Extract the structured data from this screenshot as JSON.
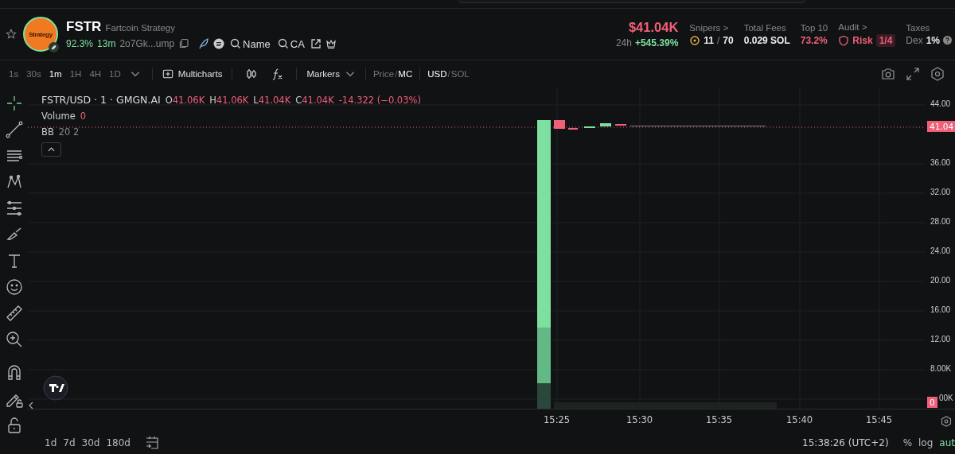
{
  "token": {
    "symbol": "FSTR",
    "name": "Fartcoin Strategy",
    "logo_text": "Strategy",
    "holders_pct": "92.3%",
    "age": "13m",
    "address": "2o7Gk...ump",
    "search_links": [
      "Name",
      "CA"
    ]
  },
  "stats": {
    "price": "$41.04K",
    "period": "24h",
    "change": "+545.39%",
    "snipers": {
      "label": "Snipers >",
      "count": "11",
      "separator": "/",
      "total": "70"
    },
    "fees": {
      "label": "Total Fees",
      "value": "0.029 SOL"
    },
    "top10": {
      "label": "Top 10",
      "value": "73.2%"
    },
    "audit": {
      "label": "Audit >",
      "risk": "Risk",
      "score": "1/4"
    },
    "taxes": {
      "label": "Taxes",
      "dex": "Dex",
      "value": "1%"
    }
  },
  "intervals": [
    {
      "label": "1s",
      "selected": false
    },
    {
      "label": "30s",
      "selected": false
    },
    {
      "label": "1m",
      "selected": true
    },
    {
      "label": "1H",
      "selected": false
    },
    {
      "label": "4H",
      "selected": false
    },
    {
      "label": "1D",
      "selected": false
    }
  ],
  "toolbar": {
    "multicharts": "Multicharts",
    "markers": "Markers",
    "value_mode_separator": "/",
    "currency_separator": "/",
    "value_mode": [
      {
        "label": "Price",
        "selected": false
      },
      {
        "label": "MC",
        "selected": true
      }
    ],
    "currency": [
      {
        "label": "USD",
        "selected": true
      },
      {
        "label": "SOL",
        "selected": false
      }
    ]
  },
  "legend": {
    "title": "FSTR/USD · 1 · GMGN.AI",
    "ohlc": [
      {
        "label": "O",
        "value": "41.06K"
      },
      {
        "label": "H",
        "value": "41.06K"
      },
      {
        "label": "L",
        "value": "41.04K"
      },
      {
        "label": "C",
        "value": "41.04K"
      }
    ],
    "change": "-14.322 (−0.03%)",
    "volume_label": "Volume",
    "volume_value": "0",
    "bb_label": "BB",
    "bb_params": "20 2"
  },
  "price_axis": {
    "labels": [
      "44.00",
      "36.00",
      "32.00",
      "28.00",
      "24.00",
      "20.00",
      "16.00",
      "12.00",
      "8.00K",
      "00K"
    ],
    "last_price": "41.04",
    "volume_badge": "0"
  },
  "time_axis": {
    "labels": [
      "15:25",
      "15:30",
      "15:35",
      "15:40",
      "15:45"
    ]
  },
  "ranges": [
    "1d",
    "7d",
    "30d",
    "180d"
  ],
  "status": {
    "time": "15:38:26 (UTC+2)",
    "percent": "%",
    "log": "log",
    "auto": "aut"
  }
}
